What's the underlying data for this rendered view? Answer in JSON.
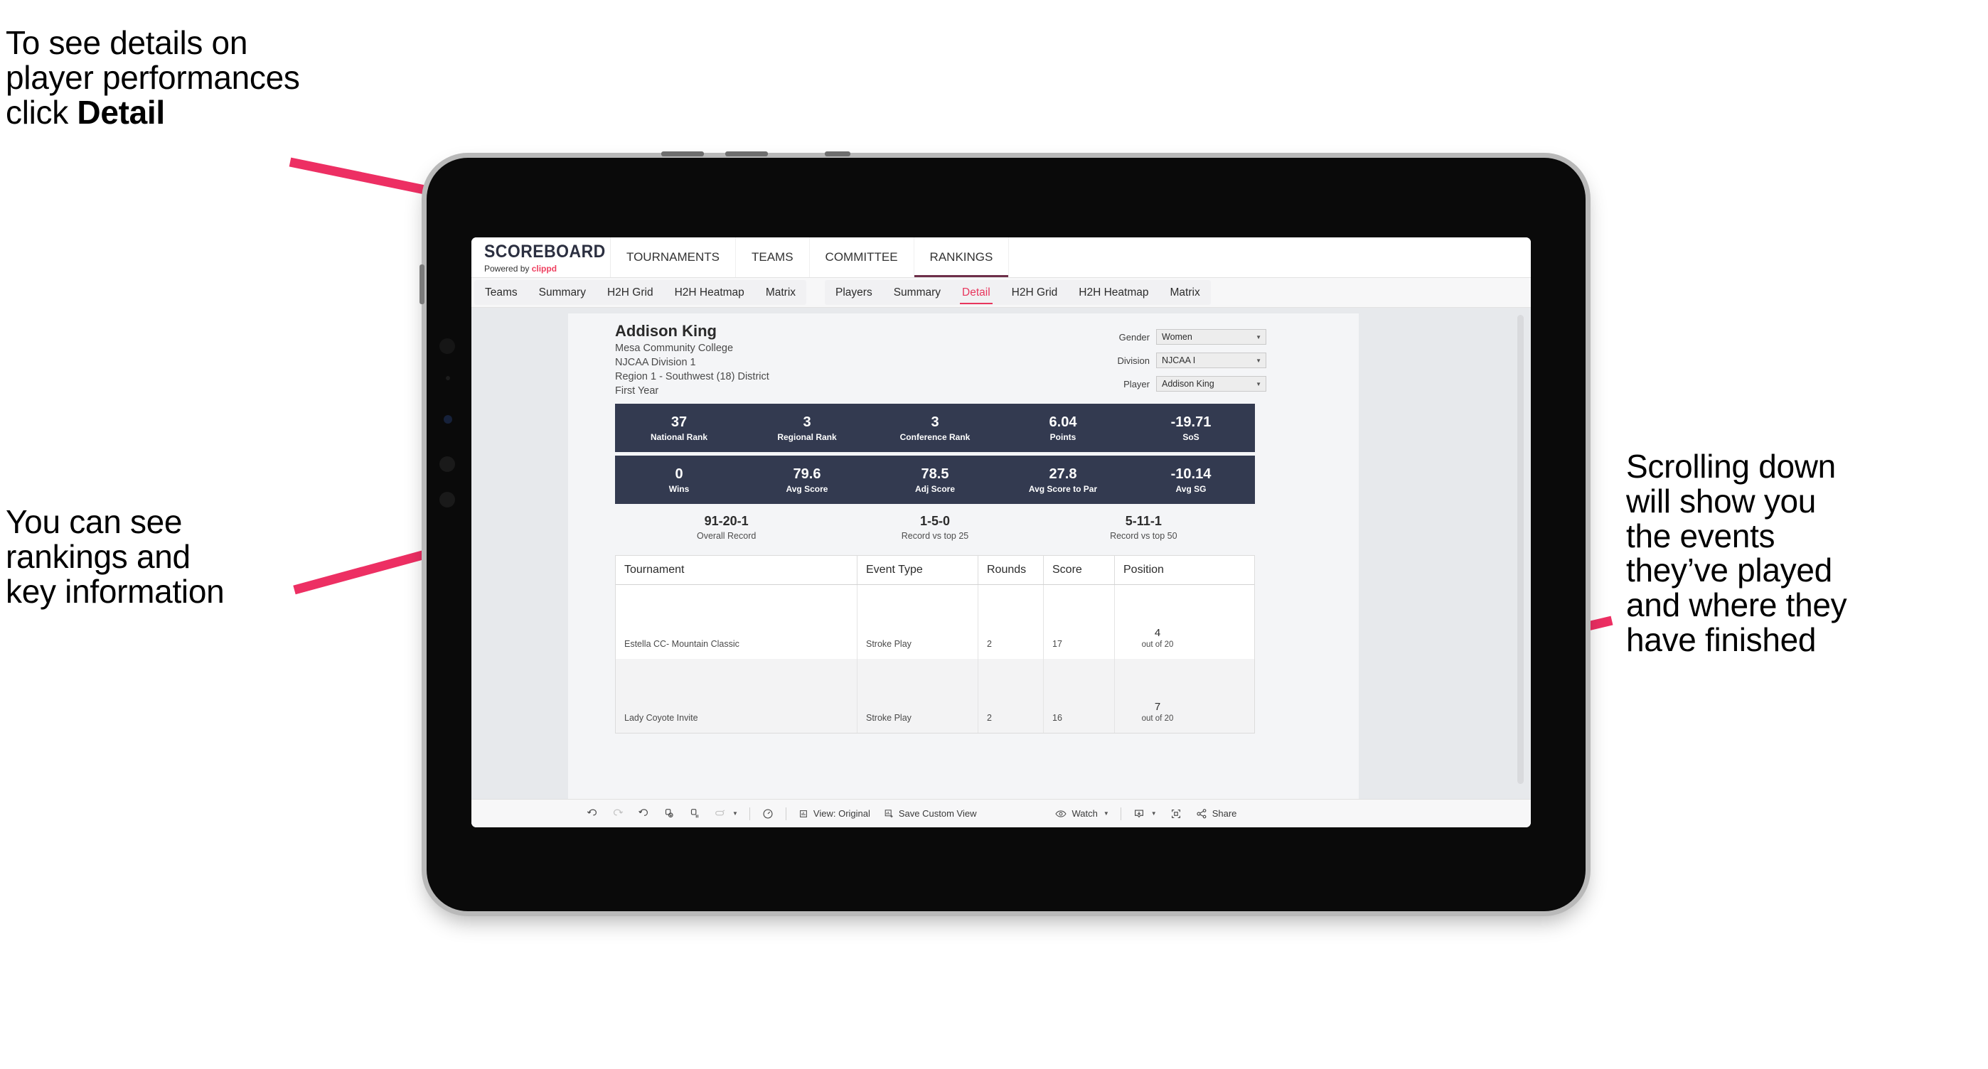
{
  "annotations": {
    "top_left": {
      "lines": [
        "To see details on",
        "player performances",
        "click "
      ],
      "bold_word": "Detail"
    },
    "left": {
      "lines": [
        "You can see",
        "rankings and",
        "key information"
      ]
    },
    "right": {
      "lines": [
        "Scrolling down",
        "will show you",
        "the events",
        "they’ve played",
        "and where they",
        "have finished"
      ]
    },
    "arrow_color": "#ed2f63"
  },
  "app": {
    "brand": {
      "title": "SCOREBOARD",
      "powered_prefix": "Powered by ",
      "powered_name": "clippd"
    },
    "top_nav": [
      {
        "label": "TOURNAMENTS",
        "active": false
      },
      {
        "label": "TEAMS",
        "active": false
      },
      {
        "label": "COMMITTEE",
        "active": false
      },
      {
        "label": "RANKINGS",
        "active": true
      }
    ],
    "tabs_group_one": [
      "Teams",
      "Summary",
      "H2H Grid",
      "H2H Heatmap",
      "Matrix"
    ],
    "tabs_group_two": [
      {
        "label": "Players",
        "selected": false
      },
      {
        "label": "Summary",
        "selected": false
      },
      {
        "label": "Detail",
        "selected": true
      },
      {
        "label": "H2H Grid",
        "selected": false
      },
      {
        "label": "H2H Heatmap",
        "selected": false
      },
      {
        "label": "Matrix",
        "selected": false
      }
    ],
    "accent_color": "#e8365d",
    "statbar_color": "#333a50"
  },
  "player": {
    "name": "Addison King",
    "school": "Mesa Community College",
    "division": "NJCAA Division 1",
    "region": "Region 1 - Southwest (18) District",
    "year": "First Year"
  },
  "selectors": [
    {
      "label": "Gender",
      "value": "Women"
    },
    {
      "label": "Division",
      "value": "NJCAA I"
    },
    {
      "label": "Player",
      "value": "Addison King"
    }
  ],
  "stats_row_one": [
    {
      "value": "37",
      "label": "National Rank"
    },
    {
      "value": "3",
      "label": "Regional Rank"
    },
    {
      "value": "3",
      "label": "Conference Rank"
    },
    {
      "value": "6.04",
      "label": "Points"
    },
    {
      "value": "-19.71",
      "label": "SoS"
    }
  ],
  "stats_row_two": [
    {
      "value": "0",
      "label": "Wins"
    },
    {
      "value": "79.6",
      "label": "Avg Score"
    },
    {
      "value": "78.5",
      "label": "Adj Score"
    },
    {
      "value": "27.8",
      "label": "Avg Score to Par"
    },
    {
      "value": "-10.14",
      "label": "Avg SG"
    }
  ],
  "records": [
    {
      "value": "91-20-1",
      "label": "Overall Record"
    },
    {
      "value": "1-5-0",
      "label": "Record vs top 25"
    },
    {
      "value": "5-11-1",
      "label": "Record vs top 50"
    }
  ],
  "table": {
    "headers": [
      "Tournament",
      "Event Type",
      "Rounds",
      "Score",
      "Position"
    ],
    "rows": [
      {
        "tournament": "Estella CC- Mountain Classic",
        "event_type": "Stroke Play",
        "rounds": "2",
        "score": "17",
        "position": "4",
        "position_sub": "out of 20"
      },
      {
        "tournament": "Lady Coyote Invite",
        "event_type": "Stroke Play",
        "rounds": "2",
        "score": "16",
        "position": "7",
        "position_sub": "out of 20"
      }
    ]
  },
  "toolbar": {
    "view_label": "View: Original",
    "save_label": "Save Custom View",
    "watch_label": "Watch",
    "share_label": "Share",
    "icons": [
      "undo-icon",
      "redo-icon",
      "revert-icon",
      "refresh-icon",
      "pause-icon",
      "alerts-icon",
      "dropdown-caret-icon",
      "clock-icon",
      "view-original-icon",
      "save-custom-view-icon",
      "eye-icon",
      "download-icon",
      "fullscreen-icon",
      "share-icon"
    ]
  }
}
